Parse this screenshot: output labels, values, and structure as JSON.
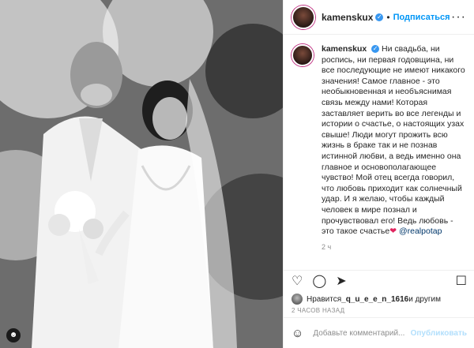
{
  "header": {
    "username": "kamenskux",
    "follow_label": "Подписаться"
  },
  "caption": {
    "username": "kamenskux",
    "text": "Ни свадьба, ни роспись, ни первая годовщина, ни все последующие не имеют никакого значения! Самое главное - это необыкновенная и необъяснимая связь между нами! Которая заставляет верить во все легенды и истории о счастье, о настоящих узах свыше! Люди могут прожить всю жизнь в браке так и не познав истинной любви, а ведь именно она главное и основополагающее чувство! Мой отец всегда говорил, что любовь приходит как солнечный удар. И я желаю, чтобы каждый человек в мире познал и прочувствовал его! Ведь любовь - это такое счастье",
    "heart": "❤",
    "mention": "@realpotap",
    "ago": "2 ч"
  },
  "likes": {
    "prefix": "Нравится ",
    "user": "_q_u_e_e_n_1616",
    "suffix": " и другим"
  },
  "timestamp": "2 ЧАСОВ НАЗАД",
  "comment": {
    "placeholder": "Добавьте комментарий...",
    "publish_label": "Опубликовать"
  },
  "icons": {
    "like": "heart-icon",
    "comment": "comment-icon",
    "share": "share-icon",
    "save": "bookmark-icon",
    "emoji": "emoji-icon",
    "more": "more-icon"
  }
}
